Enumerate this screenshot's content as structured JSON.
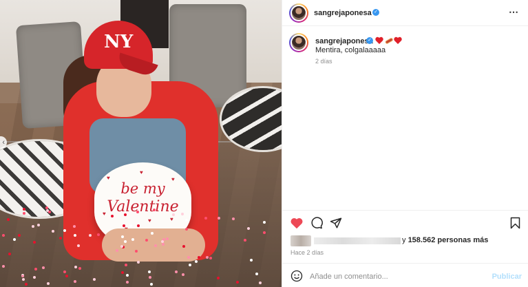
{
  "post": {
    "username": "sangrejaponesa",
    "verified": true,
    "more_icon": "⋯",
    "cap_logo": "NY",
    "cake_line1": "be my",
    "cake_line2": "Valentine",
    "caption": {
      "emojis": [
        "heart",
        "hotdog",
        "heart"
      ],
      "text": "Mentira, colgalaaaaa",
      "time": "2 días"
    },
    "likes": {
      "prefix": "y",
      "count": "158.562",
      "suffix": "personas más"
    },
    "timestamp": "Hace 2 días",
    "comment": {
      "placeholder": "Añade un comentario...",
      "publish": "Publicar"
    }
  },
  "colors": {
    "heart": "#ed4956",
    "link_blue": "#0095f6",
    "publish_disabled": "#b2dffc",
    "verified": "#3897f0"
  }
}
